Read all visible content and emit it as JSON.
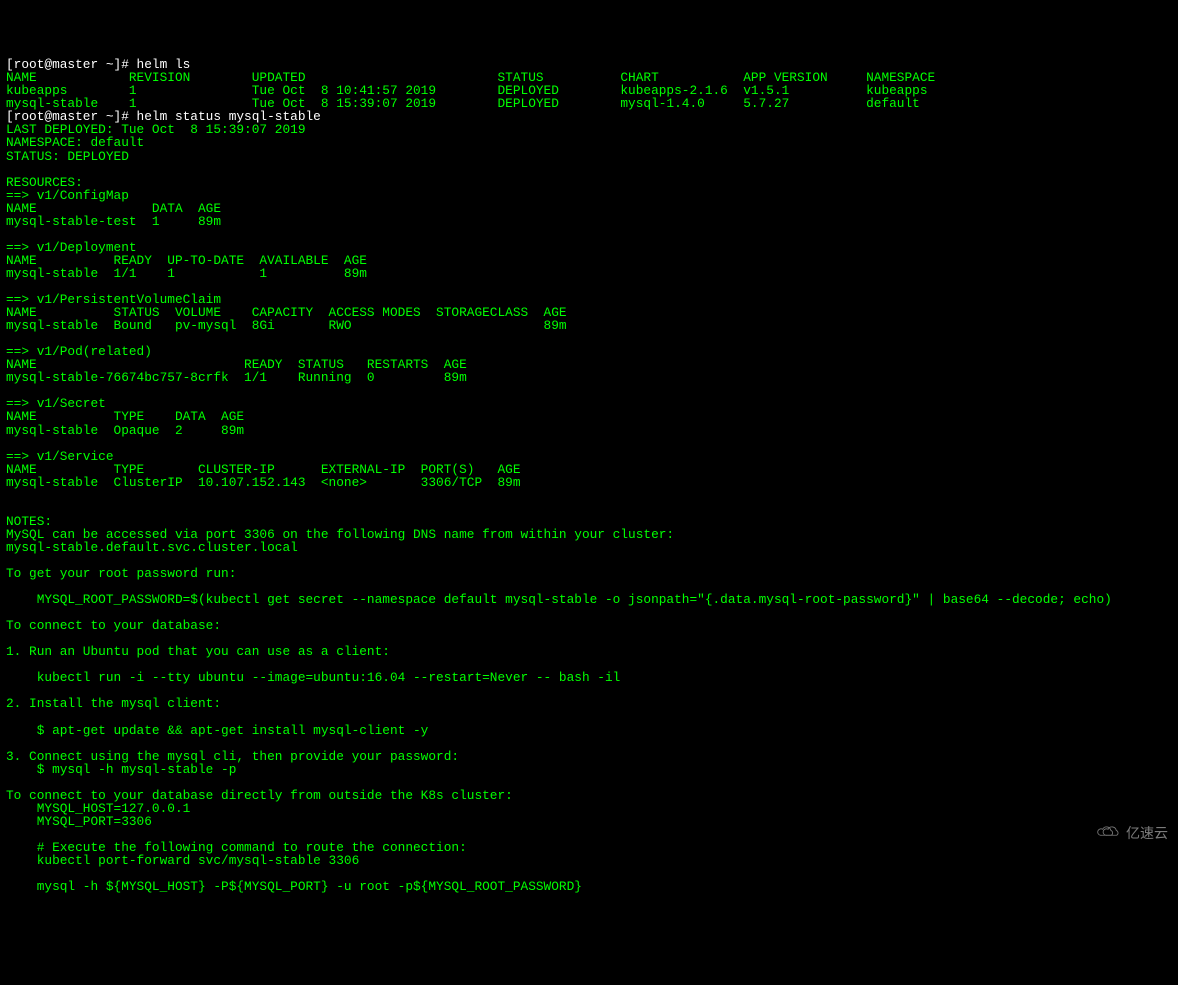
{
  "lines": [
    {
      "t": "[root@master ~]# helm ls",
      "cls": "prompt"
    },
    {
      "t": "NAME            REVISION        UPDATED                         STATUS          CHART           APP VERSION     NAMESPACE"
    },
    {
      "t": "kubeapps        1               Tue Oct  8 10:41:57 2019        DEPLOYED        kubeapps-2.1.6  v1.5.1          kubeapps "
    },
    {
      "t": "mysql-stable    1               Tue Oct  8 15:39:07 2019        DEPLOYED        mysql-1.4.0     5.7.27          default  "
    },
    {
      "t": "[root@master ~]# helm status mysql-stable",
      "cls": "prompt"
    },
    {
      "t": "LAST DEPLOYED: Tue Oct  8 15:39:07 2019"
    },
    {
      "t": "NAMESPACE: default"
    },
    {
      "t": "STATUS: DEPLOYED"
    },
    {
      "t": ""
    },
    {
      "t": "RESOURCES:"
    },
    {
      "t": "==> v1/ConfigMap"
    },
    {
      "t": "NAME               DATA  AGE"
    },
    {
      "t": "mysql-stable-test  1     89m"
    },
    {
      "t": ""
    },
    {
      "t": "==> v1/Deployment"
    },
    {
      "t": "NAME          READY  UP-TO-DATE  AVAILABLE  AGE"
    },
    {
      "t": "mysql-stable  1/1    1           1          89m"
    },
    {
      "t": ""
    },
    {
      "t": "==> v1/PersistentVolumeClaim"
    },
    {
      "t": "NAME          STATUS  VOLUME    CAPACITY  ACCESS MODES  STORAGECLASS  AGE"
    },
    {
      "t": "mysql-stable  Bound   pv-mysql  8Gi       RWO                         89m"
    },
    {
      "t": ""
    },
    {
      "t": "==> v1/Pod(related)"
    },
    {
      "t": "NAME                           READY  STATUS   RESTARTS  AGE"
    },
    {
      "t": "mysql-stable-76674bc757-8crfk  1/1    Running  0         89m"
    },
    {
      "t": ""
    },
    {
      "t": "==> v1/Secret"
    },
    {
      "t": "NAME          TYPE    DATA  AGE"
    },
    {
      "t": "mysql-stable  Opaque  2     89m"
    },
    {
      "t": ""
    },
    {
      "t": "==> v1/Service"
    },
    {
      "t": "NAME          TYPE       CLUSTER-IP      EXTERNAL-IP  PORT(S)   AGE"
    },
    {
      "t": "mysql-stable  ClusterIP  10.107.152.143  <none>       3306/TCP  89m"
    },
    {
      "t": ""
    },
    {
      "t": ""
    },
    {
      "t": "NOTES:"
    },
    {
      "t": "MySQL can be accessed via port 3306 on the following DNS name from within your cluster:"
    },
    {
      "t": "mysql-stable.default.svc.cluster.local"
    },
    {
      "t": ""
    },
    {
      "t": "To get your root password run:"
    },
    {
      "t": ""
    },
    {
      "t": "    MYSQL_ROOT_PASSWORD=$(kubectl get secret --namespace default mysql-stable -o jsonpath=\"{.data.mysql-root-password}\" | base64 --decode; echo)"
    },
    {
      "t": ""
    },
    {
      "t": "To connect to your database:"
    },
    {
      "t": ""
    },
    {
      "t": "1. Run an Ubuntu pod that you can use as a client:"
    },
    {
      "t": ""
    },
    {
      "t": "    kubectl run -i --tty ubuntu --image=ubuntu:16.04 --restart=Never -- bash -il"
    },
    {
      "t": ""
    },
    {
      "t": "2. Install the mysql client:"
    },
    {
      "t": ""
    },
    {
      "t": "    $ apt-get update && apt-get install mysql-client -y"
    },
    {
      "t": ""
    },
    {
      "t": "3. Connect using the mysql cli, then provide your password:"
    },
    {
      "t": "    $ mysql -h mysql-stable -p"
    },
    {
      "t": ""
    },
    {
      "t": "To connect to your database directly from outside the K8s cluster:"
    },
    {
      "t": "    MYSQL_HOST=127.0.0.1"
    },
    {
      "t": "    MYSQL_PORT=3306"
    },
    {
      "t": ""
    },
    {
      "t": "    # Execute the following command to route the connection:"
    },
    {
      "t": "    kubectl port-forward svc/mysql-stable 3306"
    },
    {
      "t": ""
    },
    {
      "t": "    mysql -h ${MYSQL_HOST} -P${MYSQL_PORT} -u root -p${MYSQL_ROOT_PASSWORD}"
    }
  ],
  "watermark": "亿速云"
}
